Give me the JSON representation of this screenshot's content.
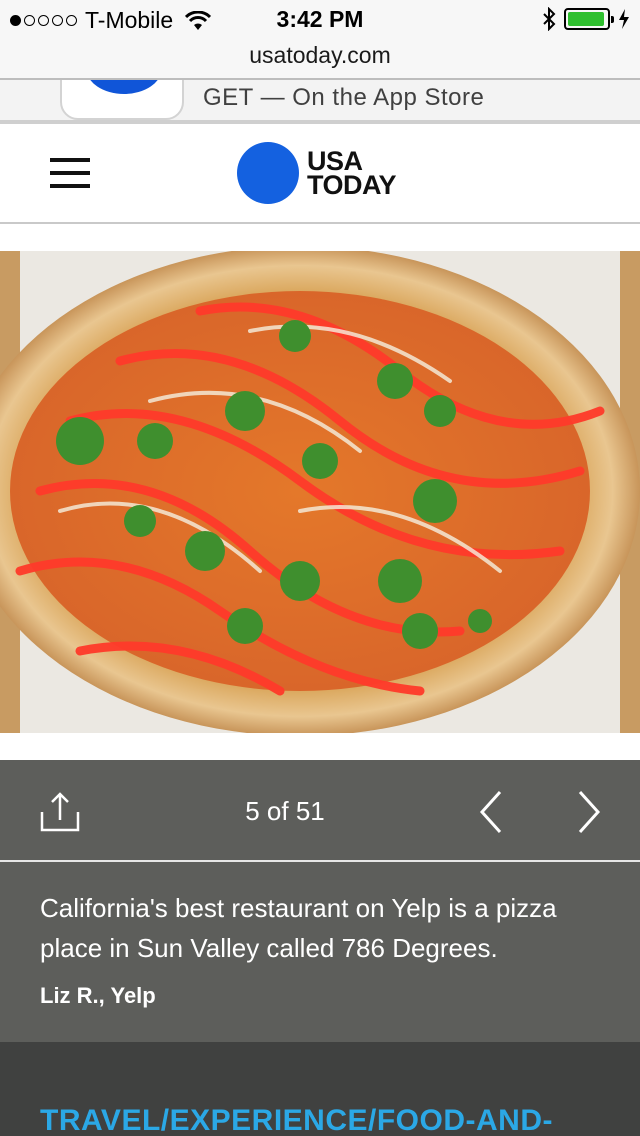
{
  "status_bar": {
    "carrier": "T-Mobile",
    "time": "3:42 PM",
    "signal_bars_filled": 1,
    "signal_bars_total": 5,
    "battery_level": 0.95
  },
  "browser": {
    "url": "usatoday.com"
  },
  "app_banner": {
    "text": "GET — On the App Store"
  },
  "header": {
    "logo_line1": "USA",
    "logo_line2": "TODAY",
    "brand_color": "#1461e0"
  },
  "gallery": {
    "counter": "5 of 51",
    "caption": "California's best restaurant on Yelp is a pizza place in Sun Valley called 786 Degrees.",
    "credit": "Liz R., Yelp"
  },
  "footer": {
    "section_link": "TRAVEL/EXPERIENCE/FOOD-AND-",
    "link_color": "#2ba8e6"
  },
  "icons": [
    "wifi-icon",
    "bluetooth-icon",
    "battery-icon",
    "charging-icon",
    "hamburger-menu-icon",
    "share-icon",
    "chevron-left-icon",
    "chevron-right-icon"
  ]
}
